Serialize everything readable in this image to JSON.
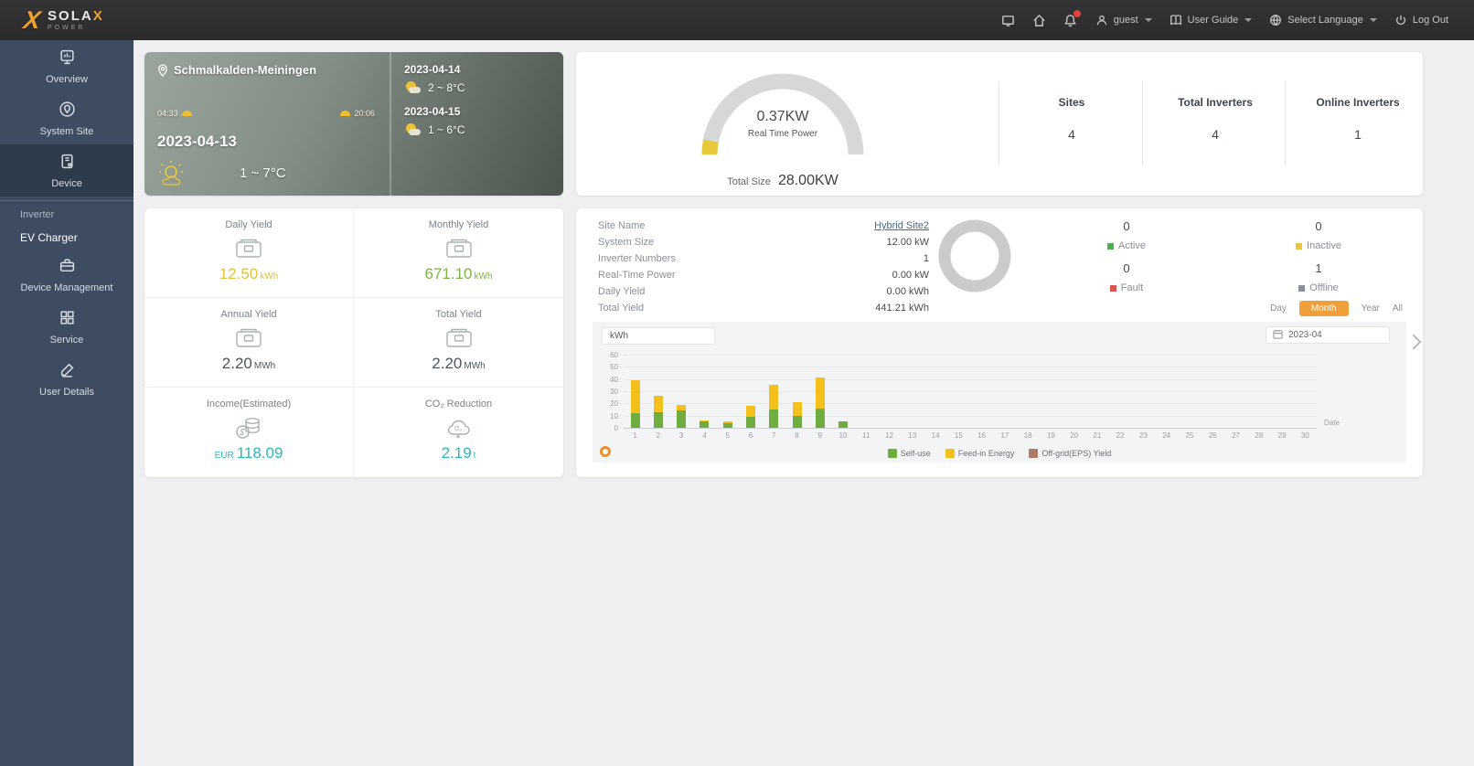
{
  "topbar": {
    "brand": "SOLA",
    "brand_x": "X",
    "brand_sub": "POWER",
    "user": "guest",
    "user_guide": "User Guide",
    "language": "Select Language",
    "logout": "Log Out"
  },
  "sidebar": {
    "items": [
      {
        "id": "overview",
        "label": "Overview",
        "icon": "monitor-icon"
      },
      {
        "id": "system-site",
        "label": "System Site",
        "icon": "site-icon"
      },
      {
        "id": "device",
        "label": "Device",
        "icon": "device-icon",
        "active": true
      },
      {
        "id": "inverter",
        "label": "Inverter",
        "sub": true
      },
      {
        "id": "ev-charger",
        "label": "EV Charger",
        "sub": true,
        "highlight": true
      },
      {
        "id": "device-management",
        "label": "Device Management",
        "icon": "toolbox-icon"
      },
      {
        "id": "service",
        "label": "Service",
        "icon": "service-icon"
      },
      {
        "id": "user-details",
        "label": "User Details",
        "icon": "pen-icon"
      }
    ]
  },
  "weather": {
    "location": "Schmalkalden-Meiningen",
    "sunrise": "04:33",
    "sunset": "20:06",
    "today_date": "2023-04-13",
    "today_temp": "1 ~ 7°C",
    "forecast": [
      {
        "date": "2023-04-14",
        "temp": "2 ~ 8°C"
      },
      {
        "date": "2023-04-15",
        "temp": "1 ~ 6°C"
      }
    ]
  },
  "summary": {
    "power_value": "0.37KW",
    "power_label": "Real Time Power",
    "total_size_label": "Total Size",
    "total_size_value": "28.00KW",
    "accent_color": "#e9c93c",
    "stats": [
      {
        "label": "Sites",
        "value": "4"
      },
      {
        "label": "Total Inverters",
        "value": "4"
      },
      {
        "label": "Online Inverters",
        "value": "1"
      }
    ]
  },
  "yields": {
    "cells": [
      {
        "label": "Daily Yield",
        "prefix": "",
        "value": "12.50",
        "unit": "kWh",
        "color": "#dfc33a",
        "icon": "meter-icon"
      },
      {
        "label": "Monthly Yield",
        "prefix": "",
        "value": "671.10",
        "unit": "kWh",
        "color": "#7cb342",
        "icon": "meter-icon"
      },
      {
        "label": "Annual Yield",
        "prefix": "",
        "value": "2.20",
        "unit": "MWh",
        "color": "#4a5560",
        "icon": "meter-icon"
      },
      {
        "label": "Total Yield",
        "prefix": "",
        "value": "2.20",
        "unit": "MWh",
        "color": "#4a5560",
        "icon": "meter-icon"
      },
      {
        "label": "Income(Estimated)",
        "prefix": "EUR",
        "value": "118.09",
        "unit": "",
        "color": "#2fb9b3",
        "icon": "income-icon"
      },
      {
        "label": "CO₂ Reduction",
        "prefix": "",
        "value": "2.19",
        "unit": "t",
        "color": "#2fb9b3",
        "icon": "co2-icon"
      }
    ]
  },
  "site_detail": {
    "rows": [
      {
        "label": "Site Name",
        "value": "Hybrid Site2",
        "link": true
      },
      {
        "label": "System Size",
        "value": "12.00 kW"
      },
      {
        "label": "Inverter Numbers",
        "value": "1"
      },
      {
        "label": "Real-Time Power",
        "value": "0.00 kW"
      },
      {
        "label": "Daily Yield",
        "value": "0.00 kWh"
      },
      {
        "label": "Total Yield",
        "value": "441.21 kWh"
      }
    ],
    "donut_color": "#c9cbcd",
    "statuses": [
      {
        "label": "Active",
        "value": "0",
        "color": "#4caf50"
      },
      {
        "label": "Inactive",
        "value": "0",
        "color": "#e8c436"
      },
      {
        "label": "Fault",
        "value": "0",
        "color": "#d9534f"
      },
      {
        "label": "Offline",
        "value": "1",
        "color": "#8a8f99"
      }
    ],
    "period_tabs": [
      {
        "label": "Day"
      },
      {
        "label": "Month",
        "active": true
      },
      {
        "label": "Year"
      },
      {
        "label": "All"
      }
    ]
  },
  "chart_data": {
    "type": "bar",
    "stacked": true,
    "unit_select": "kWh",
    "date_value": "2023-04",
    "xlabel": "Date",
    "x": [
      1,
      2,
      3,
      4,
      5,
      6,
      7,
      8,
      9,
      10,
      11,
      12,
      13,
      14,
      15,
      16,
      17,
      18,
      19,
      20,
      21,
      22,
      23,
      24,
      25,
      26,
      27,
      28,
      29,
      30
    ],
    "ylim": [
      0,
      60
    ],
    "yticks": [
      0,
      10,
      20,
      30,
      40,
      50,
      60
    ],
    "legend_position": "bottom",
    "series": [
      {
        "name": "Self-use",
        "color": "#6fae3e",
        "values": [
          12,
          13,
          14,
          5,
          4,
          9,
          15,
          10,
          16,
          5,
          0,
          0,
          0,
          0,
          0,
          0,
          0,
          0,
          0,
          0,
          0,
          0,
          0,
          0,
          0,
          0,
          0,
          0,
          0,
          0
        ]
      },
      {
        "name": "Feed-in Energy",
        "color": "#f3c01c",
        "values": [
          27,
          13,
          5,
          1,
          1,
          9,
          20,
          11,
          25,
          0,
          0,
          0,
          0,
          0,
          0,
          0,
          0,
          0,
          0,
          0,
          0,
          0,
          0,
          0,
          0,
          0,
          0,
          0,
          0,
          0
        ]
      },
      {
        "name": "Off-grid(EPS) Yield",
        "color": "#ad7a68",
        "values": [
          0,
          0,
          0,
          0,
          0,
          0,
          0,
          0,
          0,
          0,
          0,
          0,
          0,
          0,
          0,
          0,
          0,
          0,
          0,
          0,
          0,
          0,
          0,
          0,
          0,
          0,
          0,
          0,
          0,
          0
        ]
      }
    ]
  }
}
